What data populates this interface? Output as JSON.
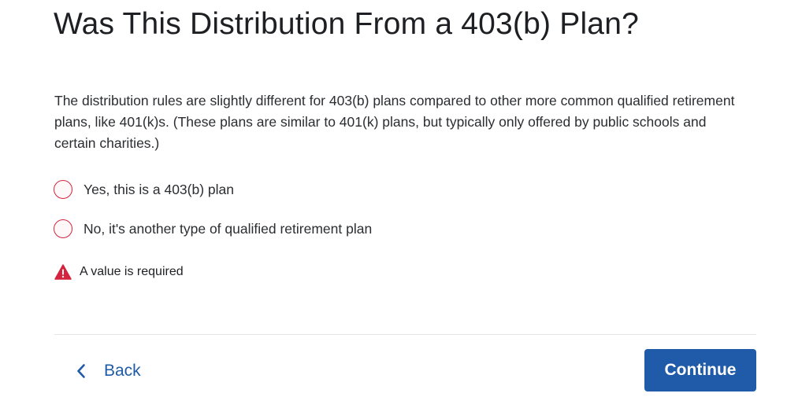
{
  "page": {
    "title": "Was This Distribution From a 403(b) Plan?",
    "description": "The distribution rules are slightly different for 403(b) plans compared to other more common qualified retirement plans, like 401(k)s. (These plans are similar to 401(k) plans, but typically only offered by public schools and certain charities.)"
  },
  "options": [
    {
      "label": "Yes, this is a 403(b) plan",
      "selected": false
    },
    {
      "label": "No, it's another type of qualified retirement plan",
      "selected": false
    }
  ],
  "validation": {
    "message": "A value is required",
    "icon": "warning-triangle-icon",
    "color": "#d5233f"
  },
  "footer": {
    "back_label": "Back",
    "continue_label": "Continue"
  },
  "colors": {
    "accent": "#1f5ba8",
    "error": "#d5233f"
  }
}
